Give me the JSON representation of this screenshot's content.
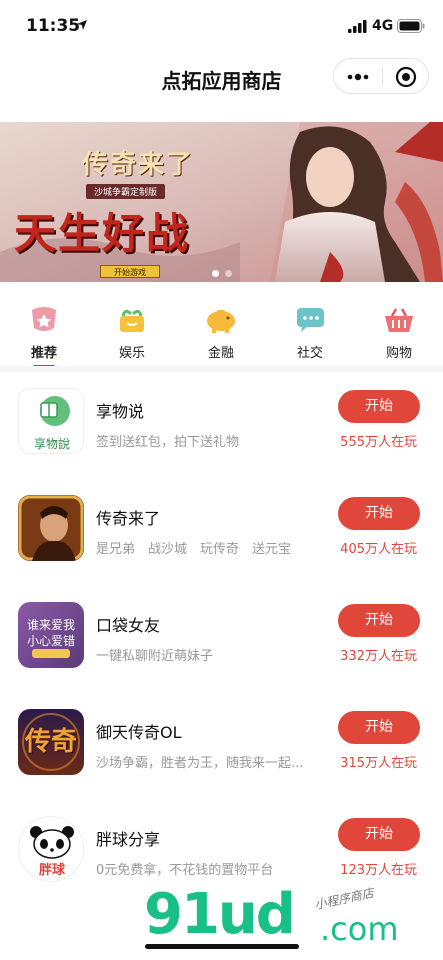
{
  "status_bar": {
    "time": "11:35",
    "network": "4G"
  },
  "nav": {
    "title": "点拓应用商店"
  },
  "banner": {
    "logo_text": "传奇来了",
    "subtitle": "沙城争霸定制版",
    "headline": "天生好战",
    "button_label": "开始游戏",
    "slides": 2,
    "active_slide": 0
  },
  "tabs": [
    {
      "label": "推荐",
      "icon": "star-icon",
      "active": true
    },
    {
      "label": "娱乐",
      "icon": "gift-icon",
      "active": false
    },
    {
      "label": "金融",
      "icon": "piggy-bank-icon",
      "active": false
    },
    {
      "label": "社交",
      "icon": "chat-icon",
      "active": false
    },
    {
      "label": "购物",
      "icon": "basket-icon",
      "active": false
    }
  ],
  "apps": [
    {
      "name": "享物说",
      "desc": "签到送红包，拍下送礼物",
      "button": "开始",
      "players": "555万人在玩",
      "icon": "xiangwushuo-logo",
      "icon_text": "享物說"
    },
    {
      "name": "传奇来了",
      "desc": "是兄弟　战沙城　玩传奇　送元宝",
      "button": "开始",
      "players": "405万人在玩",
      "icon": "legend-game-icon"
    },
    {
      "name": "口袋女友",
      "desc": "一键私聊附近萌妹子",
      "button": "开始",
      "players": "332万人在玩",
      "icon": "pocket-girlfriend-icon",
      "icon_text_1": "谁来爱我",
      "icon_text_2": "小心爱错"
    },
    {
      "name": "御天传奇OL",
      "desc": "沙场争霸，胜者为王，随我来一起...",
      "button": "开始",
      "players": "315万人在玩",
      "icon": "yutian-legend-icon",
      "icon_text": "传奇"
    },
    {
      "name": "胖球分享",
      "desc": "0元免费拿，不花钱的置物平台",
      "button": "开始",
      "players": "123万人在玩",
      "icon": "panda-icon",
      "icon_text": "胖球"
    }
  ],
  "watermark": {
    "brand": "91ud",
    "domain": ".com",
    "handwriting": "小程序商店"
  },
  "colors": {
    "accent": "#e0463a",
    "tab_underline": "#e43b2c",
    "watermark": "#18c088"
  }
}
